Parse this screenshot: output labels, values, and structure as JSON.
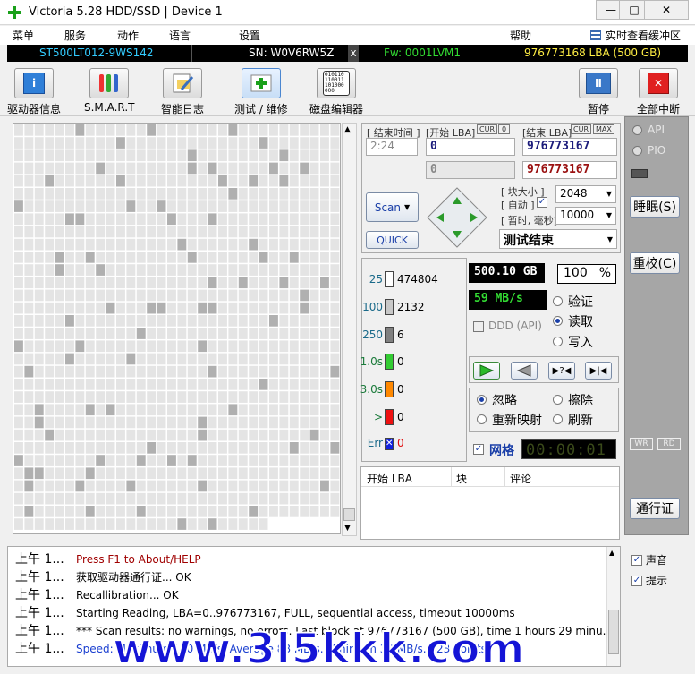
{
  "window": {
    "title": "Victoria 5.28 HDD/SSD | Device 1",
    "min": "—",
    "max": "□",
    "close": "✕"
  },
  "menu": {
    "left": [
      "菜单",
      "服务",
      "动作",
      "语言",
      "设置"
    ],
    "help": "帮助",
    "cache": "实时查看缓冲区"
  },
  "infobar": {
    "model": "ST500LT012-9WS142",
    "serial": "SN: W0V6RW5Z",
    "x": "x",
    "fw": "Fw: 0001LVM1",
    "lba": "976773168 LBA (500 GB)",
    "colors": {
      "model": "#33ccff",
      "serial": "#ffffff",
      "fw": "#33dd33",
      "lba": "#ffee44"
    }
  },
  "toolbar": {
    "drive_info": "驱动器信息",
    "smart": "S.M.A.R.T",
    "smart_log": "智能日志",
    "test": "测试 / 维修",
    "disk_editor": "磁盘编辑器",
    "pause": "暂停",
    "stop_all": "全部中断",
    "disk_editor_glyph": "010110\n110011\n101000\n000"
  },
  "range": {
    "end_time_label": "[ 结束时间 ]",
    "start_lba_label": "[开始 LBA]",
    "cur": "CUR",
    "zero": "0",
    "end_lba_label": "[结束 LBA]",
    "max": "MAX",
    "time_value": "2:24",
    "start_lba": "0",
    "end_lba": "976773167",
    "cur_lba": "0",
    "cur_end_lba": "976773167"
  },
  "scan": {
    "scan_button": "Scan",
    "quick_button": "QUICK",
    "block_label": "[ 块大小 ]",
    "auto_label": "[ 自动 ]",
    "block_size": "2048",
    "timeout_label": "[ 暂时, 毫秒]",
    "timeout_value": "10000",
    "status": "测试结束"
  },
  "stats": [
    {
      "ms": "25",
      "count": "474804",
      "color": "#ffffff"
    },
    {
      "ms": "100",
      "count": "2132",
      "color": "#c8c8c8"
    },
    {
      "ms": "250",
      "count": "6",
      "color": "#808080"
    },
    {
      "ms": "1.0s",
      "count": "0",
      "color": "#33cc33"
    },
    {
      "ms": "3.0s",
      "count": "0",
      "color": "#ff8800"
    },
    {
      "ms": ">",
      "count": "0",
      "color": "#ee1111"
    },
    {
      "ms": "Err",
      "count": "0",
      "color": "#1122dd"
    }
  ],
  "progress": {
    "size": "500.10 GB",
    "percent": "100",
    "percent_sign": "%",
    "speed": "59 MB/s",
    "ddd": "DDD (API)"
  },
  "mode": {
    "verify": "验证",
    "read": "读取",
    "write": "写入",
    "selected": "read"
  },
  "action": {
    "ignore": "忽略",
    "erase": "擦除",
    "remap": "重新映射",
    "refresh": "刷新",
    "selected": "ignore"
  },
  "grid_label": "网格",
  "timer": "00:00:01",
  "table": {
    "headers": [
      "开始 LBA",
      "块",
      "评论"
    ]
  },
  "right": {
    "api": "API",
    "pio": "PIO",
    "sleep": "睡眠(S)",
    "recal": "重校(C)",
    "wr": "WR",
    "rd": "RD",
    "passport": "通行证"
  },
  "log": [
    {
      "time": "上午 1...",
      "text": "Press F1 to About/HELP",
      "color": "#a00000"
    },
    {
      "time": "上午 1...",
      "text": "获取驱动器通行证... OK",
      "color": "#000000"
    },
    {
      "time": "上午 1...",
      "text": "Recallibration... OK",
      "color": "#000000"
    },
    {
      "time": "上午 1...",
      "text": "Starting Reading, LBA=0..976773167, FULL, sequential access, timeout 10000ms",
      "color": "#000000"
    },
    {
      "time": "上午 1...",
      "text": "*** Scan results: no warnings, no errors. Last block at 976773167 (500 GB), time 1 hours 29 minu...",
      "color": "#000000"
    },
    {
      "time": "上午 1...",
      "text": "Speed: Maximum 130 MB/s. Average 88 MB/s. Minimum 38 MB/s. 423 points.",
      "color": "#1a3fd0"
    }
  ],
  "options": {
    "sound": "声音",
    "hints": "提示"
  },
  "watermark": "www.3l5kkk.com"
}
